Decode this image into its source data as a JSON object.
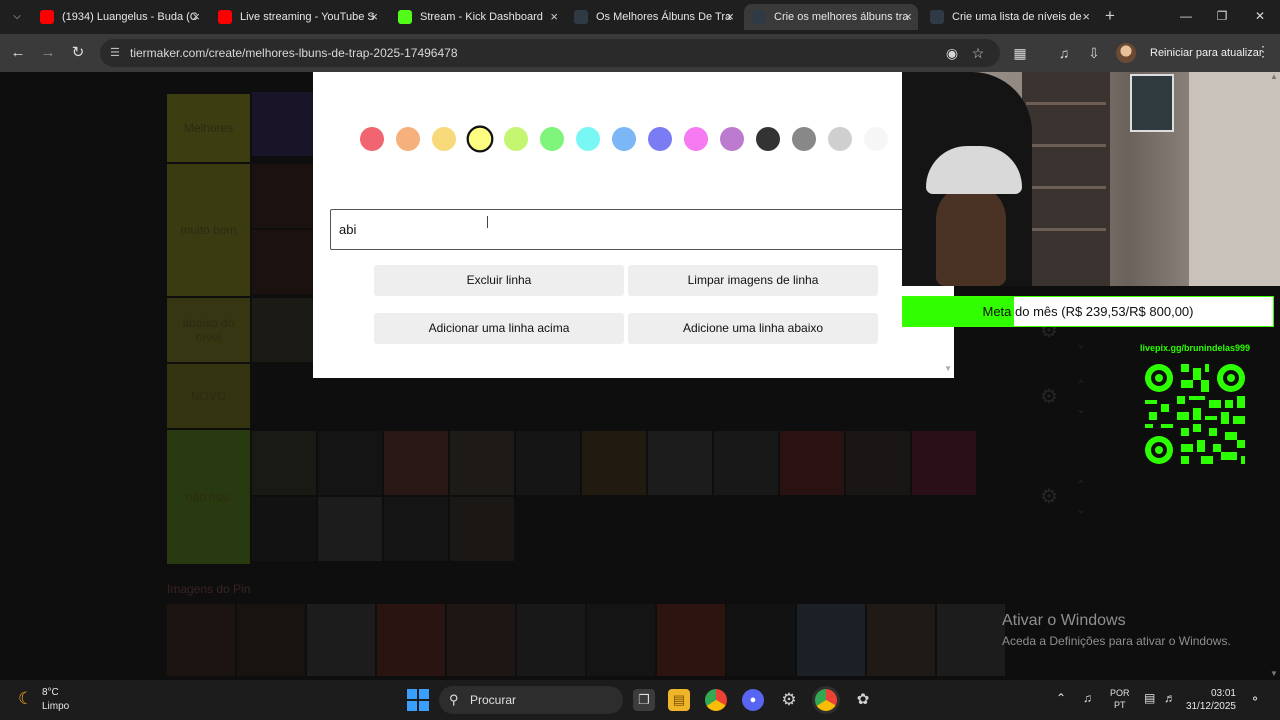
{
  "browser": {
    "tabs": [
      {
        "title": "(1934) Luangelus - Buda (C",
        "active": false,
        "favicon_color": "#ff0000"
      },
      {
        "title": "Live streaming - YouTube S",
        "active": false,
        "favicon_color": "#ff0000"
      },
      {
        "title": "Stream - Kick Dashboard",
        "active": false,
        "favicon_color": "#53fc18"
      },
      {
        "title": "Os Melhores Álbuns De Tra",
        "active": false,
        "favicon_color": "#2f3a44"
      },
      {
        "title": "Crie os melhores álbuns tra",
        "active": true,
        "favicon_color": "#2f3a44"
      },
      {
        "title": "Crie uma lista de níveis de",
        "active": false,
        "favicon_color": "#2f3a44"
      }
    ],
    "new_tab": "+",
    "url": "tiermaker.com/create/melhores-lbuns-de-trap-2025-17496478",
    "relaunch_label": "Reiniciar para atualizar"
  },
  "tiers": [
    {
      "label": "Melhores",
      "color": "#3d3d12"
    },
    {
      "label": "muito bom",
      "color": "#3b3b12"
    },
    {
      "label": "abaixo do nível",
      "color": "#363612"
    },
    {
      "label": "NOVO",
      "color": "#343410"
    },
    {
      "label": "não ouvi",
      "color": "#2a3a10"
    }
  ],
  "pin_images_label": "Imagens do Pin",
  "modal": {
    "swatches": [
      {
        "color": "#f0656f",
        "selected": false
      },
      {
        "color": "#f6b07b",
        "selected": false
      },
      {
        "color": "#f7d97a",
        "selected": false
      },
      {
        "color": "#fdfd84",
        "selected": true
      },
      {
        "color": "#c4f570",
        "selected": false
      },
      {
        "color": "#7ef57a",
        "selected": false
      },
      {
        "color": "#78f7f5",
        "selected": false
      },
      {
        "color": "#7bb6f6",
        "selected": false
      },
      {
        "color": "#7b7bf3",
        "selected": false
      },
      {
        "color": "#f67bf2",
        "selected": false
      },
      {
        "color": "#bd7bcf",
        "selected": false
      },
      {
        "color": "#333333",
        "selected": false
      },
      {
        "color": "#888888",
        "selected": false
      },
      {
        "color": "#cfcfcf",
        "selected": false
      },
      {
        "color": "#f6f6f6",
        "selected": false
      }
    ],
    "label_value": "abi",
    "buttons": {
      "delete_row": "Excluir linha",
      "clear_row_images": "Limpar imagens de linha",
      "add_row_above": "Adicionar uma linha acima",
      "add_row_below": "Adicione uma linha abaixo"
    }
  },
  "stream_overlay": {
    "goal_text": "Meta do mês (R$ 239,53/R$ 800,00)",
    "goal_progress": 0.299,
    "goal_color": "#31ff00",
    "qr_label": "livepix.gg/brunindelas999"
  },
  "windows_activation": {
    "title": "Ativar o Windows",
    "subtitle": "Aceda a Definições para ativar o Windows."
  },
  "taskbar": {
    "temperature": "8°C",
    "condition": "Limpo",
    "search_label": "Procurar",
    "language": "POR",
    "region": "PT",
    "time": "03:01",
    "date": "31/12/2025"
  }
}
